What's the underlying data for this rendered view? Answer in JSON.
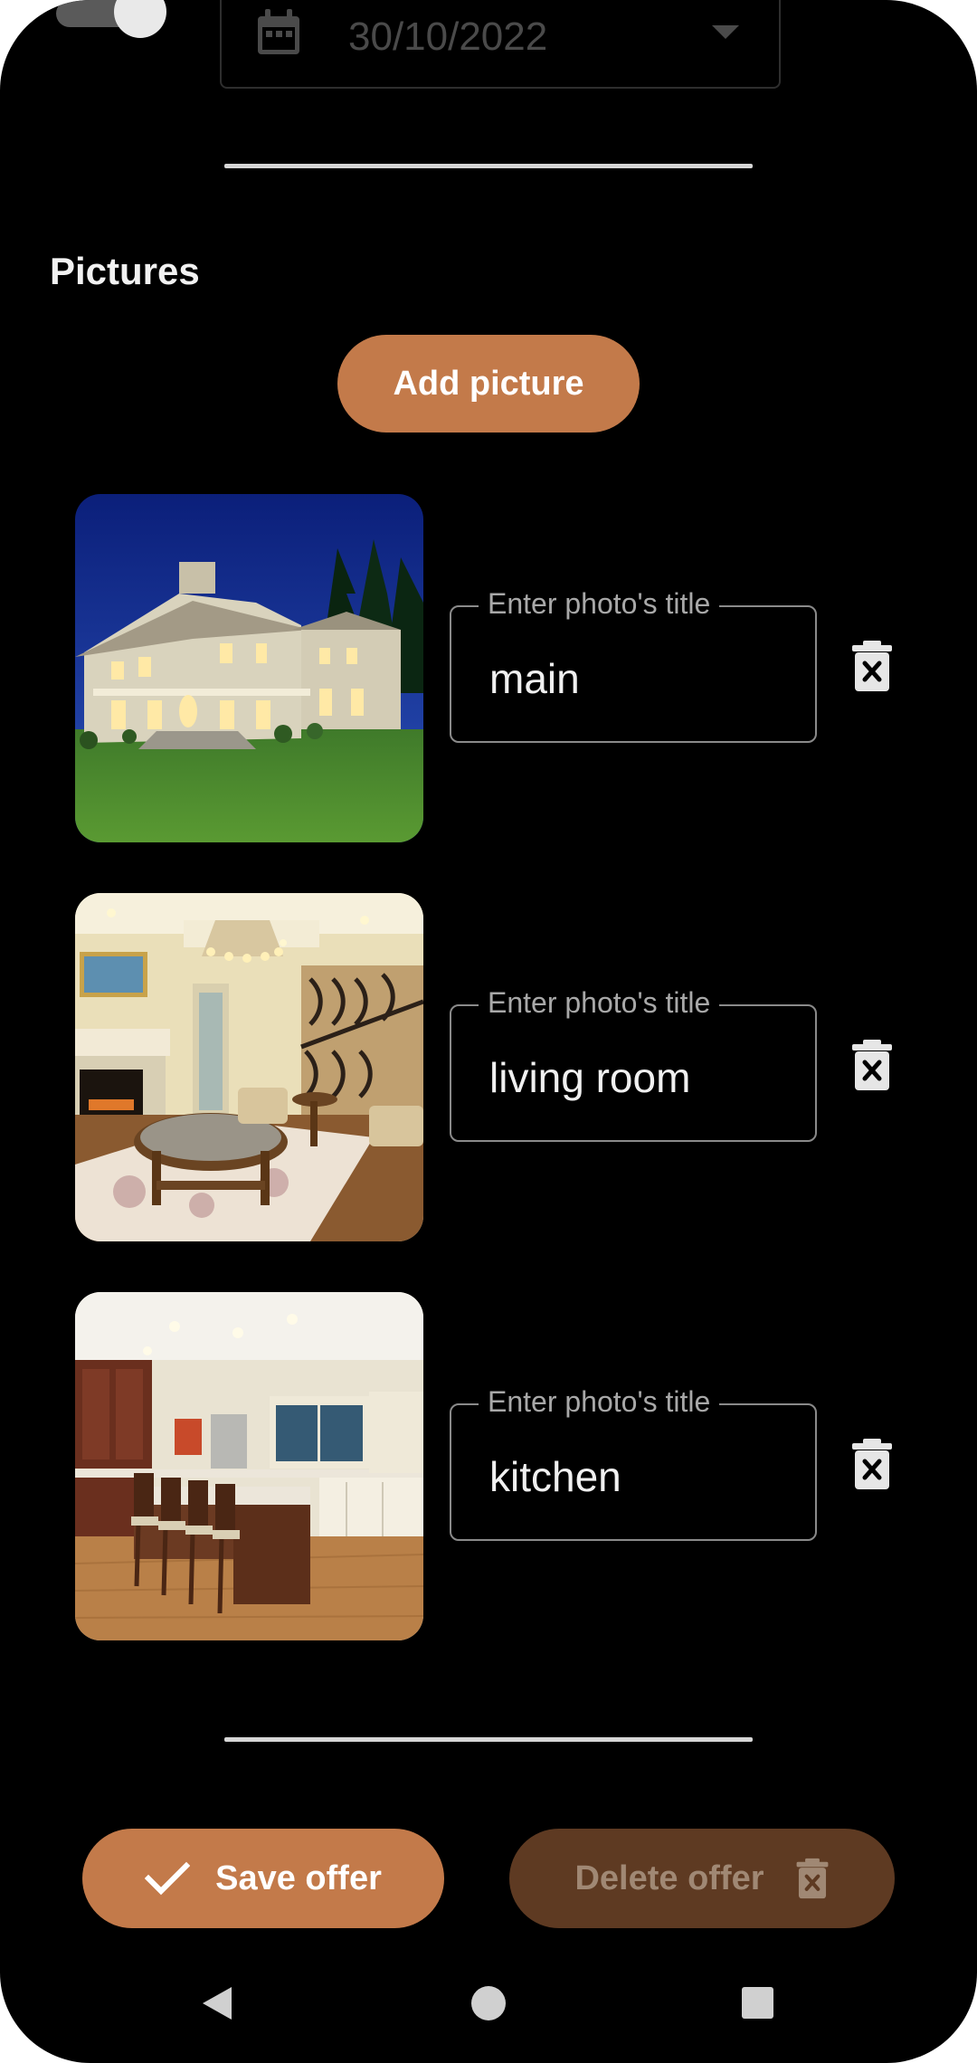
{
  "date_field": {
    "value": "30/10/2022",
    "icon": "calendar-icon"
  },
  "pictures": {
    "title": "Pictures",
    "add_label": "Add picture",
    "items": [
      {
        "label": "Enter photo's title",
        "value": "main"
      },
      {
        "label": "Enter photo's title",
        "value": "living room"
      },
      {
        "label": "Enter photo's title",
        "value": "kitchen"
      }
    ]
  },
  "actions": {
    "save_label": "Save offer",
    "delete_label": "Delete offer"
  },
  "colors": {
    "accent": "#c37a4a",
    "accent_disabled": "#5e3a22",
    "background": "#000000"
  }
}
